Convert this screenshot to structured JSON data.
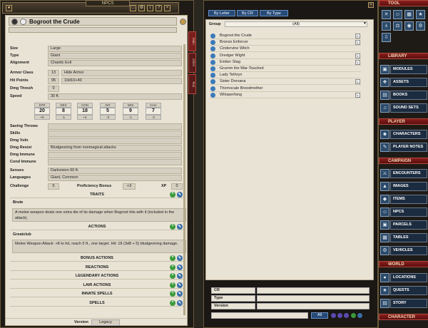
{
  "sheet": {
    "name": "Bogroot the Crude",
    "fields": [
      {
        "label": "Size",
        "value": "Large"
      },
      {
        "label": "Type",
        "value": "Giant"
      },
      {
        "label": "Alignment",
        "value": "Chaotic Evil"
      }
    ],
    "armor_class": {
      "label": "Armor Class",
      "value": "13",
      "detail": "Hide Armor"
    },
    "hit_points": {
      "label": "Hit Points",
      "value": "95",
      "detail": "10d10+40"
    },
    "dmg_thresh": {
      "label": "Dmg Thresh",
      "value": "0"
    },
    "speed": {
      "label": "Speed",
      "value": "30 ft."
    },
    "abilities": [
      {
        "name": "STR",
        "score": "20",
        "mod": "+5"
      },
      {
        "name": "DEX",
        "score": "8",
        "mod": "-1"
      },
      {
        "name": "CON",
        "score": "18",
        "mod": "+4"
      },
      {
        "name": "INT",
        "score": "5",
        "mod": "-3"
      },
      {
        "name": "WIS",
        "score": "9",
        "mod": "-1"
      },
      {
        "name": "CHA",
        "score": "7",
        "mod": "-2"
      }
    ],
    "props": [
      {
        "label": "Saving Throws",
        "value": ""
      },
      {
        "label": "Skills",
        "value": ""
      },
      {
        "label": "Dmg Vuln",
        "value": ""
      },
      {
        "label": "Dmg Resist",
        "value": "Bludgeoning from nonmagical attacks"
      },
      {
        "label": "Dmg Immune",
        "value": ""
      },
      {
        "label": "Cond Immune",
        "value": ""
      },
      {
        "label": "Senses",
        "value": "Darkvision 60 ft."
      },
      {
        "label": "Languages",
        "value": "Giant, Common"
      }
    ],
    "challenge": {
      "label": "Challenge",
      "value": "5"
    },
    "prof": {
      "label": "Proficiency Bonus",
      "value": "+3"
    },
    "xp": {
      "label": "XP",
      "value": "0"
    },
    "traits_header": "TRAITS",
    "trait_name": "Brute",
    "trait_text": "A melee weapon deals one extra die of its damage when Bogroot hits with it (included in the attack).",
    "actions_header": "ACTIONS",
    "action_name": "Greatclub",
    "action_text": "Melee Weapon Attack: +8 to hit, reach 5 ft., one target. Hit: 18 (3d8 + 5) bludgeoning damage.",
    "sections": [
      "BONUS ACTIONS",
      "REACTIONS",
      "LEGENDARY ACTIONS",
      "LAIR ACTIONS",
      "INNATE SPELLS",
      "SPELLS"
    ],
    "version_label": "Version",
    "version_value": "Legacy"
  },
  "tabs": [
    "Main",
    "Other",
    "Text"
  ],
  "npcs": {
    "title": "NPCS",
    "filters": [
      "By Letter",
      "By CR",
      "By Type"
    ],
    "group_label": "Group",
    "group_value": "(All)",
    "list": [
      "Bogroot the Crude",
      "Bronze Enforcer",
      "Cindervine Witch",
      "Dredger Wight",
      "Ember Stag",
      "Grumm the War-Touched",
      "Lady Tethryn",
      "Sister Drevana",
      "Thornscale Broodmother",
      "Whisperfang"
    ],
    "locked": [
      true,
      true,
      false,
      true,
      true,
      false,
      false,
      true,
      false,
      true
    ],
    "lock_glyph": "L",
    "filter_fields": [
      "CR",
      "Type",
      "Version"
    ],
    "all_button": "All"
  },
  "sidebar": {
    "tool_header": "TOOL",
    "library_header": "LIBRARY",
    "library": [
      "MODULES",
      "ASSETS",
      "BOOKS",
      "SOUND SETS"
    ],
    "player_header": "PLAYER",
    "player": [
      "CHARACTERS",
      "PLAYER NOTES"
    ],
    "campaign_header": "CAMPAIGN",
    "campaign": [
      "ENCOUNTERS",
      "IMAGES",
      "ITEMS",
      "NPCS",
      "PARCELS",
      "TABLES",
      "VEHICLES"
    ],
    "world_header": "WORLD",
    "world": [
      "LOCATIONS",
      "QUESTS",
      "STORY"
    ],
    "character_header": "CHARACTER"
  }
}
